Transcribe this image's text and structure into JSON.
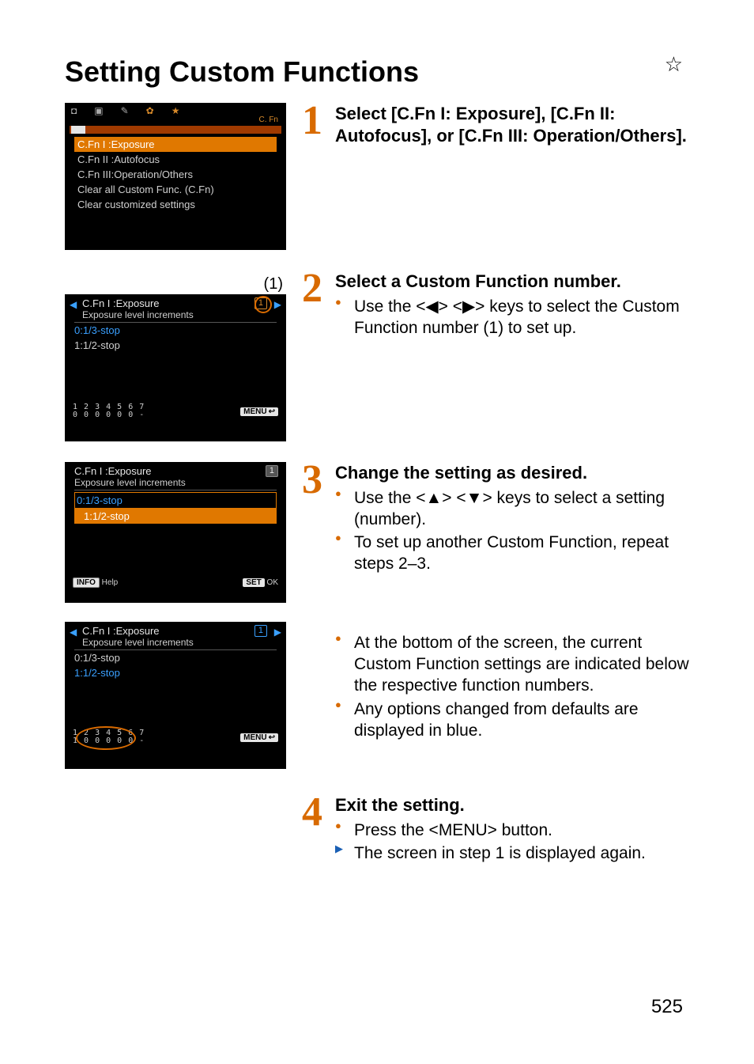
{
  "page": {
    "title": "Setting Custom Functions",
    "star": "☆",
    "number": "525"
  },
  "steps": {
    "s1": {
      "num": "1",
      "head": "Select [C.Fn I: Exposure], [C.Fn II: Autofocus], or [C.Fn III: Operation/Others]."
    },
    "s2": {
      "num": "2",
      "head": "Select a Custom Function number.",
      "b1_a": "Use the <",
      "b1_b": "> <",
      "b1_c": "> keys to select the Custom Function number (1) to set up.",
      "key_left": "◀",
      "key_right": "▶"
    },
    "s3": {
      "num": "3",
      "head": "Change the setting as desired.",
      "b1_a": "Use the <",
      "b1_b": "> <",
      "b1_c": "> keys to select a setting (number).",
      "key_up": "▲",
      "key_down": "▼",
      "b2": "To set up another Custom Function, repeat steps 2–3.",
      "b3": "At the bottom of the screen, the current Custom Function settings are indicated below the respective function numbers.",
      "b4": "Any options changed from defaults are displayed in blue."
    },
    "s4": {
      "num": "4",
      "head": "Exit the setting.",
      "b1_a": "Press the <",
      "b1_b": "> button.",
      "menu_label": "MENU",
      "b2": "The screen in step 1 is displayed again."
    }
  },
  "screens": {
    "callout1": "(1)",
    "sc1": {
      "cfn": "C. Fn",
      "items": [
        "C.Fn I :Exposure",
        "C.Fn II :Autofocus",
        "C.Fn III:Operation/Others",
        "Clear all Custom Func. (C.Fn)",
        "Clear customized settings"
      ],
      "tabs": {
        "camera": "◘",
        "play": "▣",
        "wrench": "✎",
        "cog": "✿",
        "star": "★"
      }
    },
    "sc2": {
      "title": "C.Fn I :Exposure",
      "sub": "Exposure level increments",
      "badge": "1",
      "opt0": "0:1/3-stop",
      "opt1": "1:1/2-stop",
      "nums_top": "1 2 3 4 5 6 7",
      "nums_bot": "0 0 0 0 0 0 -",
      "menu": "MENU"
    },
    "sc3": {
      "title": "C.Fn I :Exposure",
      "sub": "Exposure level increments",
      "badge": "1",
      "opt0": "0:1/3-stop",
      "opt1": "1:1/2-stop",
      "info": "INFO",
      "help": "Help",
      "set": "SET",
      "ok": "OK"
    },
    "sc4": {
      "title": "C.Fn I :Exposure",
      "sub": "Exposure level increments",
      "badge": "1",
      "opt0": "0:1/3-stop",
      "opt1": "1:1/2-stop",
      "nums_top": "1 2 3 4 5 6 7",
      "nums_bot": "1 0 0 0 0 0 -",
      "menu": "MENU"
    }
  }
}
